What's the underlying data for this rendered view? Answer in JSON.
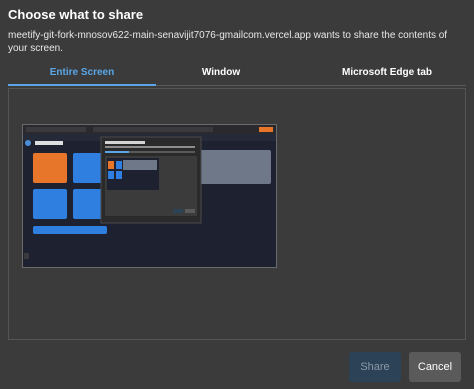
{
  "dialog": {
    "title": "Choose what to share",
    "description": "meetify-git-fork-mnosov622-main-senavijit7076-gmailcom.vercel.app wants to share the contents of your screen."
  },
  "tabs": [
    {
      "label": "Entire Screen",
      "active": true
    },
    {
      "label": "Window",
      "active": false
    },
    {
      "label": "Microsoft Edge tab",
      "active": false
    }
  ],
  "buttons": {
    "share_label": "Share",
    "cancel_label": "Cancel"
  },
  "colors": {
    "background": "#3b3b3b",
    "accent": "#5aa6e8",
    "share_disabled": "#2c4257",
    "cancel": "#5a5a5a"
  }
}
